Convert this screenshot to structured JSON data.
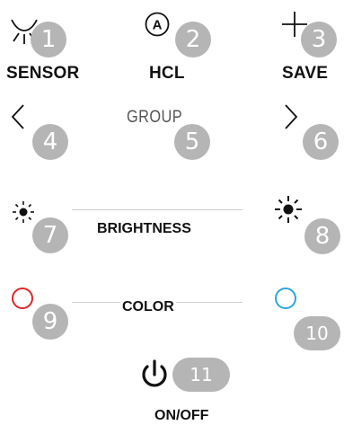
{
  "controls": {
    "sensor": {
      "label": "SENSOR",
      "badge": "1",
      "icon": "sensor-icon"
    },
    "hcl": {
      "label": "HCL",
      "badge": "2",
      "icon": "auto-a-icon"
    },
    "save": {
      "label": "SAVE",
      "badge": "3",
      "icon": "plus-icon"
    },
    "prev": {
      "badge": "4",
      "icon": "chevron-left-icon"
    },
    "group": {
      "label": "GROUP",
      "badge": "5"
    },
    "next": {
      "badge": "6",
      "icon": "chevron-right-icon"
    },
    "brightness_down": {
      "badge": "7",
      "icon": "sun-small-icon"
    },
    "brightness": {
      "label": "BRIGHTNESS"
    },
    "brightness_up": {
      "badge": "8",
      "icon": "sun-large-icon"
    },
    "color_warm": {
      "badge": "9",
      "icon": "red-circle-icon",
      "color": "#e0252a"
    },
    "color": {
      "label": "COLOR"
    },
    "color_cool": {
      "badge": "10",
      "icon": "blue-circle-icon",
      "color": "#2aa6df"
    },
    "power": {
      "label": "ON/OFF",
      "badge": "11",
      "icon": "power-icon"
    }
  },
  "colors": {
    "badge": "#b5b5b5",
    "line": "#cfcfcf"
  }
}
